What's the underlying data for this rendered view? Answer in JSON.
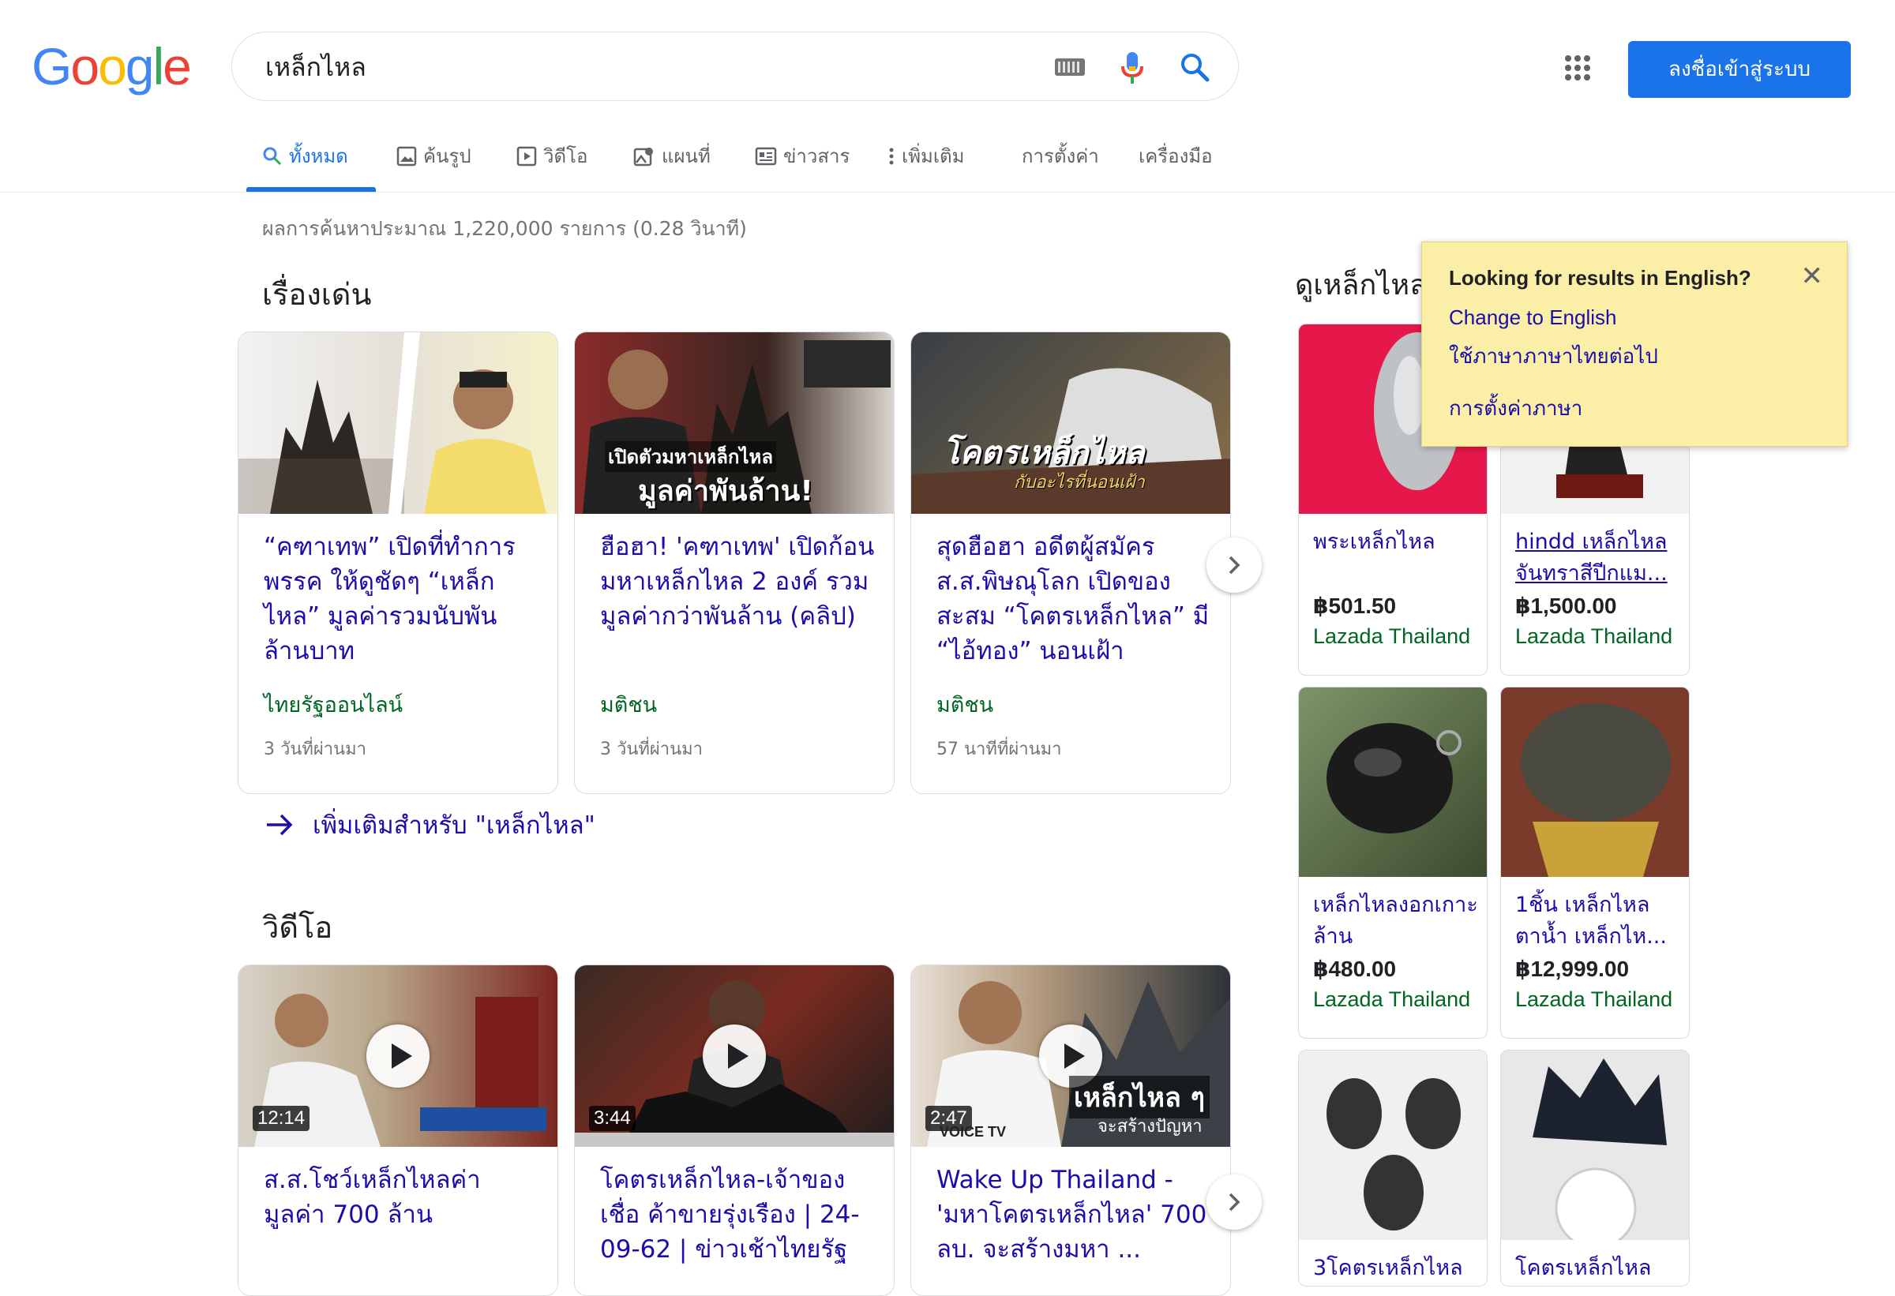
{
  "logo": {
    "letters": [
      "G",
      "o",
      "o",
      "g",
      "l",
      "e"
    ],
    "colors": [
      "#4285F4",
      "#EA4335",
      "#FBBC05",
      "#4285F4",
      "#34A853",
      "#EA4335"
    ]
  },
  "search": {
    "query": "เหล็กไหล"
  },
  "header": {
    "signin_label": "ลงชื่อเข้าสู่ระบบ"
  },
  "tabs": [
    {
      "label": "ทั้งหมด",
      "icon": "search-icon"
    },
    {
      "label": "ค้นรูป",
      "icon": "image-icon"
    },
    {
      "label": "วิดีโอ",
      "icon": "video-icon"
    },
    {
      "label": "แผนที่",
      "icon": "map-icon"
    },
    {
      "label": "ข่าวสาร",
      "icon": "news-icon"
    },
    {
      "label": "เพิ่มเติม",
      "icon": "more-vert-icon"
    },
    {
      "label": "การตั้งค่า"
    },
    {
      "label": "เครื่องมือ"
    }
  ],
  "stats": "ผลการค้นหาประมาณ 1,220,000 รายการ (0.28 วินาที)",
  "top_stories": {
    "title": "เรื่องเด่น",
    "cards": [
      {
        "title": "“คฑาเทพ” เปิดที่ทำการพรรค ให้ดูชัดๆ “เหล็กไหล” มูลค่ารวมนับพันล้านบาท",
        "source": "ไทยรัฐออนไลน์",
        "time": "3 วันที่ผ่านมา"
      },
      {
        "title": "ฮือฮา! 'คฑาเทพ' เปิดก้อนมหาเหล็กไหล 2 องค์ รวมมูลค่ากว่าพันล้าน (คลิป)",
        "source": "มติชน",
        "time": "3 วันที่ผ่านมา",
        "overlay1": "เปิดตัวมหาเหล็กไหล",
        "overlay2": "มูลค่าพันล้าน!"
      },
      {
        "title": "สุดฮือฮา อดีตผู้สมัคร ส.ส.พิษณุโลก เปิดของสะสม “โคตรเหล็กไหล” มี “ไอ้ทอง” นอนเฝ้า",
        "source": "มติชน",
        "time": "57 นาทีที่ผ่านมา",
        "overlay1": "โคตรเหล็กไหล",
        "overlay2": "กับอะไรที่นอนเฝ้า"
      }
    ],
    "more_link": "เพิ่มเติมสำหรับ \"เหล็กไหล\""
  },
  "videos": {
    "title": "วิดีโอ",
    "items": [
      {
        "title": "ส.ส.โชว์เหล็กไหลค่ามูลค่า 700 ล้าน",
        "duration": "12:14"
      },
      {
        "title": "โคตรเหล็กไหล-เจ้าของเชื่อ ค้าขายรุ่งเรือง | 24-09-62 | ข่าวเช้าไทยรัฐ",
        "duration": "3:44"
      },
      {
        "title": "Wake Up Thailand - 'มหาโคตรเหล็กไหล' 700 ลบ. จะสร้างมหา ...",
        "duration": "2:47",
        "overlay1": "เหล็กไหล ๆ",
        "overlay2": "จะสร้างปัญหา",
        "brand": "VOICE TV"
      }
    ]
  },
  "shopping": {
    "title": "ดูเหล็กไหล",
    "products": [
      {
        "name": "พระเหล็กไหล",
        "price": "฿501.50",
        "store": "Lazada Thailand"
      },
      {
        "name": "hindd เหล็กไหล จันทราสีปีกแม...",
        "price": "฿1,500.00",
        "store": "Lazada Thailand"
      },
      {
        "name": "เหล็กไหลงอกเกาะล้าน",
        "price": "฿480.00",
        "store": "Lazada Thailand"
      },
      {
        "name": "1ชิ้น เหล็กไหล ตาน้ำ เหล็กไห...",
        "price": "฿12,999.00",
        "store": "Lazada Thailand"
      },
      {
        "name": "3โคตรเหล็กไหล"
      },
      {
        "name": "โคตรเหล็กไหล"
      }
    ]
  },
  "language_popup": {
    "question": "Looking for results in English?",
    "change": "Change to English",
    "keep": "ใช้ภาษาภาษาไทยต่อไป",
    "settings": "การตั้งค่าภาษา"
  }
}
